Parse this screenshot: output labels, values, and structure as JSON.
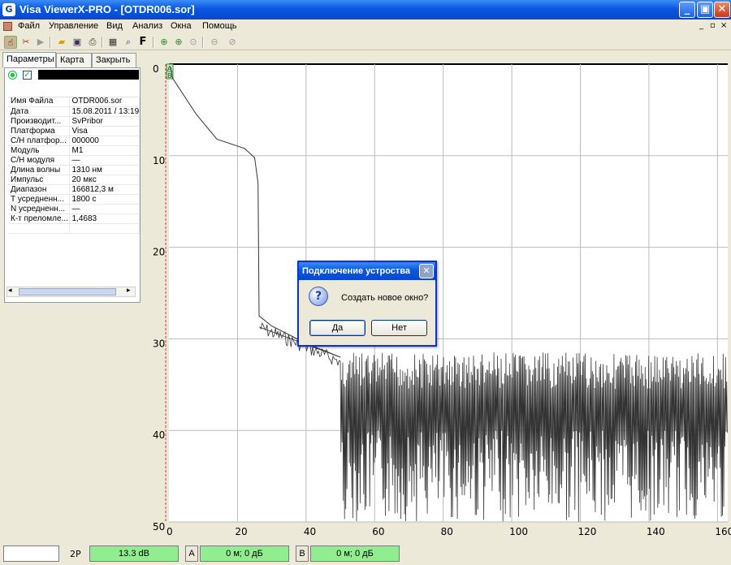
{
  "window": {
    "title": "Visa ViewerX-PRO - [OTDR006.sor]",
    "minimize": "_",
    "maximize": "▣",
    "close": "✕"
  },
  "menu": {
    "items": [
      "Файл",
      "Управление",
      "Вид",
      "Анализ",
      "Окна",
      "Помощь"
    ],
    "mdi_minimize": "_",
    "mdi_restore": "▫",
    "mdi_close": "×"
  },
  "toolbar": {
    "icons": [
      "cursor-icon",
      "edit-icon",
      "play-icon",
      "open-folder-icon",
      "save-icon",
      "print-icon",
      "table-icon",
      "search-icon",
      "font-icon",
      "zoom-in-icon",
      "zoom-in-alt-icon",
      "zoom-fit-icon",
      "zoom-out-icon",
      "zoom-reset-icon"
    ],
    "font_label": "F"
  },
  "left_panel": {
    "tabs": [
      "Параметры",
      "Карта",
      "Закрыть"
    ],
    "params": [
      [
        "Имя Файла",
        "OTDR006.sor"
      ],
      [
        "Дата",
        "15.08.2011 / 13:19"
      ],
      [
        "Производит...",
        "SvPribor"
      ],
      [
        "Платформа",
        "Visa"
      ],
      [
        "С/Н платфор...",
        "000000"
      ],
      [
        "Модуль",
        "M1"
      ],
      [
        "С/Н модуля",
        "—"
      ],
      [
        "Длина волны",
        "1310 нм"
      ],
      [
        "Импульс",
        "20 мкс"
      ],
      [
        "Диапазон",
        "166812,3 м"
      ],
      [
        "Т усредненн...",
        "1800 с"
      ],
      [
        "N усредненн...",
        "—"
      ],
      [
        "К-т преломле...",
        "1,4683"
      ]
    ]
  },
  "chart_data": {
    "type": "line",
    "x_ticks": [
      "0",
      "20",
      "40",
      "60",
      "80",
      "100",
      "120",
      "140",
      "160"
    ],
    "y_ticks": [
      "0",
      "10",
      "20",
      "30",
      "40",
      "50"
    ],
    "xlim": [
      0,
      163
    ],
    "ylim": [
      0,
      50
    ],
    "y_inverted": true,
    "grid": true,
    "color": "#333333",
    "markers": [
      "A",
      "B"
    ],
    "trace_points": [
      [
        0.5,
        0.3
      ],
      [
        1,
        1.5
      ],
      [
        8,
        5.5
      ],
      [
        14,
        8.2
      ],
      [
        22,
        9.2
      ],
      [
        25,
        10.2
      ],
      [
        26,
        13
      ],
      [
        26.3,
        27.5
      ],
      [
        30,
        28.6
      ],
      [
        40,
        30.5
      ],
      [
        50,
        32
      ]
    ],
    "noise_floor": {
      "from_x": 50,
      "to_x": 163,
      "level_top": 31.5,
      "level_bottom": 50
    }
  },
  "dialog": {
    "title": "Подключение устроства",
    "message": "Создать новое окно?",
    "yes": "Да",
    "no": "Нет",
    "icon": "?"
  },
  "status": {
    "field1": "",
    "label_2p": "2P",
    "value_2p": "13.3 dB",
    "label_a": "A",
    "value_a": "0 м; 0 дБ",
    "label_b": "B",
    "value_b": "0 м; 0 дБ"
  }
}
